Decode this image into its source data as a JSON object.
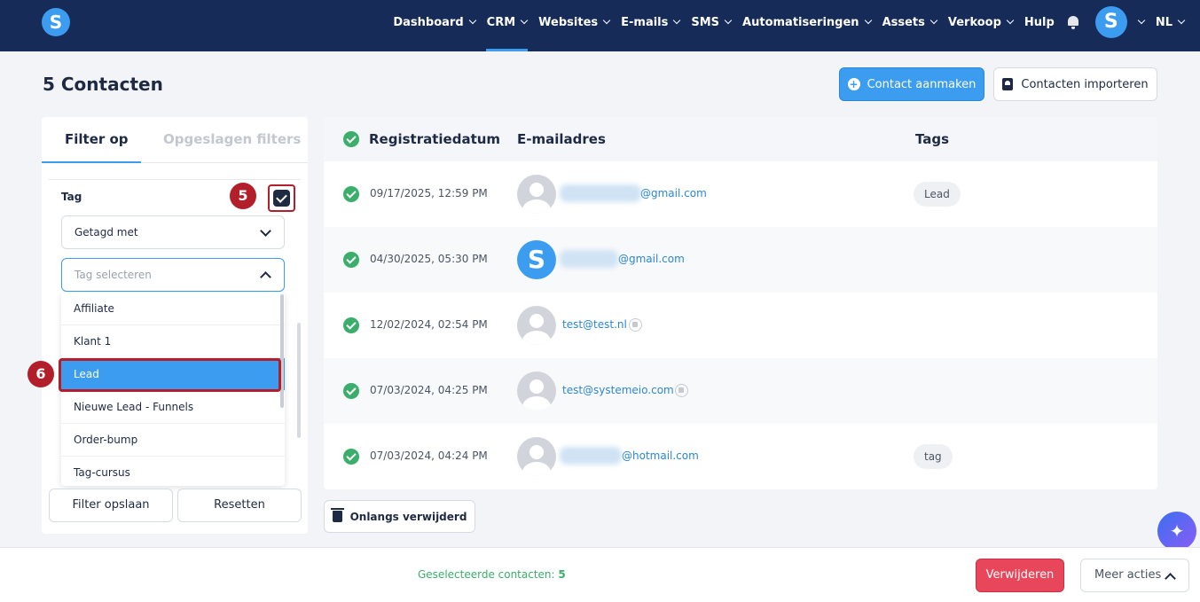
{
  "nav": {
    "logo": "S",
    "items": [
      {
        "label": "Dashboard",
        "has_menu": true
      },
      {
        "label": "CRM",
        "has_menu": true,
        "active": true
      },
      {
        "label": "Websites",
        "has_menu": true
      },
      {
        "label": "E-mails",
        "has_menu": true
      },
      {
        "label": "SMS",
        "has_menu": true
      },
      {
        "label": "Automatiseringen",
        "has_menu": true
      },
      {
        "label": "Assets",
        "has_menu": true
      },
      {
        "label": "Verkoop",
        "has_menu": true
      },
      {
        "label": "Hulp",
        "has_menu": false
      }
    ],
    "avatar": "S",
    "language": "NL"
  },
  "page": {
    "title": "5 Contacten",
    "create_button": "Contact aanmaken",
    "import_button": "Contacten importeren"
  },
  "filter": {
    "tab_active": "Filter op",
    "tab_inactive": "Opgeslagen filters",
    "tag_label": "Tag",
    "tag_checked": true,
    "condition_select": "Getagd met",
    "tag_search_placeholder": "Tag selecteren",
    "options": [
      "Affiliate",
      "Klant 1",
      "Lead",
      "Nieuwe Lead - Funnels",
      "Order-bump",
      "Tag-cursus"
    ],
    "selected_option": "Lead",
    "save_button": "Filter opslaan",
    "reset_button": "Resetten"
  },
  "markers": {
    "step5": "5",
    "step6": "6"
  },
  "table": {
    "headers": {
      "date": "Registratiedatum",
      "email": "E-mailadres",
      "tags": "Tags"
    },
    "rows": [
      {
        "date": "09/17/2025, 12:59 PM",
        "email": "@gmail.com",
        "avatar": "default",
        "tag": "Lead"
      },
      {
        "date": "04/30/2025, 05:30 PM",
        "email": "@gmail.com",
        "avatar": "S",
        "tag": ""
      },
      {
        "date": "12/02/2024, 02:54 PM",
        "email": "test@test.nl",
        "avatar": "default",
        "tag": ""
      },
      {
        "date": "07/03/2024, 04:25 PM",
        "email": "test@systemeio.com",
        "avatar": "default",
        "tag": ""
      },
      {
        "date": "07/03/2024, 04:24 PM",
        "email": "@hotmail.com",
        "avatar": "default",
        "tag": "tag"
      }
    ]
  },
  "recently_deleted_button": "Onlangs verwijderd",
  "bottom": {
    "selected_label": "Geselecteerde contacten:",
    "selected_count": "5",
    "delete_button": "Verwijderen",
    "more_button": "Meer acties"
  },
  "colors": {
    "navbar": "#162b57",
    "accent": "#3b9cf0",
    "success": "#3aae6a",
    "danger": "#e8465a",
    "marker": "#b21e2a"
  },
  "icons": {
    "ai_assistant": "sparkle-icon"
  }
}
